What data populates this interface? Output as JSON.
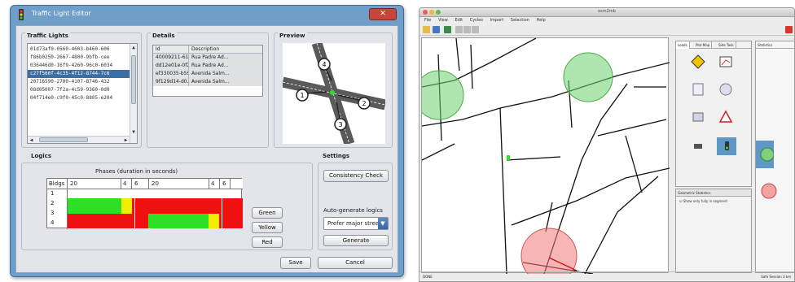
{
  "editor": {
    "title": "Traffic Light Editor",
    "close_label": "✕",
    "traffic_lights": {
      "title": "Traffic Lights",
      "items": [
        "01d73af0-0560-4603-b460-606",
        "f86b0250-2667-4800-9bfb-cee",
        "036446d0-16f9-4260-96c0-6034",
        "c27f560f-4c35-4f12-8744-7c6",
        "20716590-2700-4107-8746-432",
        "08d05007-7f2a-4c59-9360-0d0",
        "04f714e0-c9f0-45c0-8805-e204"
      ],
      "selected_index": 3
    },
    "details": {
      "title": "Details",
      "columns": [
        "Id",
        "Description"
      ],
      "rows": [
        {
          "id": "40009211-61e...",
          "desc": "Rua Padre Ad..."
        },
        {
          "id": "dd12e01e-0f2...",
          "desc": "Rua Padre Ad..."
        },
        {
          "id": "ef330035-b59...",
          "desc": "Avenida Salm..."
        },
        {
          "id": "9f129d14-d0...",
          "desc": "Avenida Salm..."
        }
      ]
    },
    "preview": {
      "title": "Preview",
      "markers": [
        "1",
        "2",
        "3",
        "4"
      ]
    },
    "logics": {
      "title": "Logics",
      "phases_title": "Phases (duration in seconds)",
      "header": [
        "Bldgs",
        "20",
        "4",
        "6",
        "20",
        "4",
        "6"
      ],
      "row_labels": [
        "1",
        "2",
        "3",
        "4"
      ],
      "colors": {
        "green": "#2ee025",
        "red": "#f01010",
        "yellow": "#f2ee00"
      }
    },
    "buttons": {
      "green": "Green",
      "yellow": "Yellow",
      "red": "Red",
      "save": "Save",
      "cancel": "Cancel"
    },
    "settings": {
      "title": "Settings",
      "consistency_check": "Consistency Check",
      "auto_generate_label": "Auto-generate logics",
      "strategy_value": "Prefer major streets",
      "generate": "Generate"
    }
  },
  "mac_app": {
    "title": "osm2mb",
    "menu": [
      "File",
      "View",
      "Edit",
      "Cycles",
      "Import",
      "Selection",
      "Help"
    ],
    "palette_tabs": [
      "Loads",
      "Plot Map",
      "Side Task"
    ],
    "road_panel_title": "Geometric Statistics",
    "road_panel_check": "Show only fully in segment",
    "side_panel_title": "Statistics",
    "status_left": "DONE",
    "status_right": "Safe Session 3 km"
  }
}
